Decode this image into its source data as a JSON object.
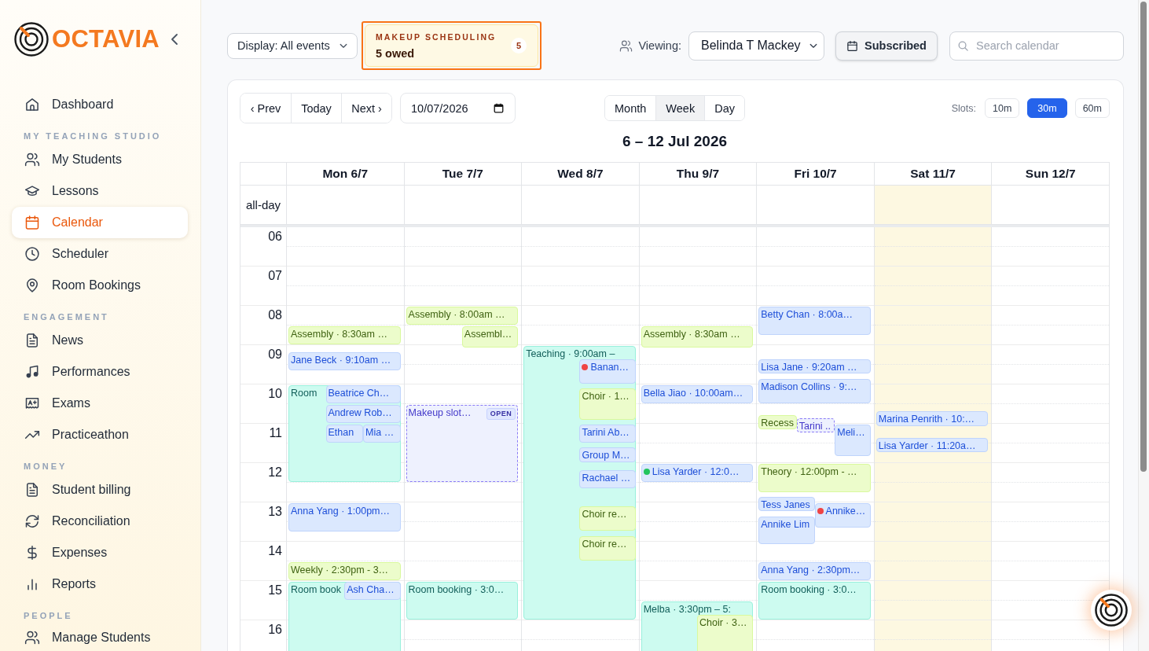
{
  "sidebar": {
    "logo": "OCTAVIA",
    "groups": [
      {
        "items": [
          {
            "label": "Dashboard",
            "selected": false
          }
        ]
      },
      {
        "heading": "MY TEACHING STUDIO",
        "items": [
          {
            "label": "My Students",
            "selected": false
          },
          {
            "label": "Lessons",
            "selected": false
          },
          {
            "label": "Calendar",
            "selected": true
          },
          {
            "label": "Scheduler",
            "selected": false
          },
          {
            "label": "Room Bookings",
            "selected": false
          }
        ]
      },
      {
        "heading": "ENGAGEMENT",
        "items": [
          {
            "label": "News",
            "selected": false
          },
          {
            "label": "Performances",
            "selected": false
          },
          {
            "label": "Exams",
            "selected": false
          },
          {
            "label": "Practiceathon",
            "selected": false
          }
        ]
      },
      {
        "heading": "MONEY",
        "items": [
          {
            "label": "Student billing",
            "selected": false
          },
          {
            "label": "Reconciliation",
            "selected": false
          },
          {
            "label": "Expenses",
            "selected": false
          },
          {
            "label": "Reports",
            "selected": false
          }
        ]
      },
      {
        "heading": "PEOPLE",
        "items": [
          {
            "label": "Manage Students",
            "selected": false
          }
        ]
      }
    ]
  },
  "toolbar": {
    "display_filter": "Display: All events",
    "makeup": {
      "title": "MAKEUP SCHEDULING",
      "summary": "5 owed",
      "count": "5",
      "highlighted": true
    },
    "viewing_label": "Viewing:",
    "viewing_value": "Belinda T Mackey",
    "subscribe_button": "Subscribed",
    "search": {
      "placeholder": "Search calendar"
    }
  },
  "calendar": {
    "nav_buttons": [
      "‹ Prev",
      "Today",
      "Next ›"
    ],
    "date_field": {
      "value": "10/07/2026"
    },
    "views": [
      {
        "label": "Month",
        "selected": false
      },
      {
        "label": "Week",
        "selected": true
      },
      {
        "label": "Day",
        "selected": false
      }
    ],
    "slots_label": "Slots:",
    "slots": [
      {
        "label": "10m",
        "selected": false
      },
      {
        "label": "30m",
        "selected": true
      },
      {
        "label": "60m",
        "selected": false
      }
    ],
    "title": "6 – 12 Jul 2026",
    "all_day_label": "all-day",
    "hours": [
      "06",
      "07",
      "08",
      "09",
      "10",
      "11",
      "12",
      "13",
      "14",
      "15",
      "16"
    ],
    "days": [
      {
        "label": "Mon 6/7",
        "today": false,
        "events": [
          {
            "text": "Assembly · 8:30am …",
            "kind": "group"
          },
          {
            "text": "Jane Beck · 9:10am …",
            "kind": "lesson"
          },
          {
            "text": "Room",
            "kind": "booking"
          },
          {
            "text": "Beatrice Ch…",
            "kind": "lesson"
          },
          {
            "text": "Andrew Rob…",
            "kind": "lesson"
          },
          {
            "text": "Ethan",
            "kind": "lesson"
          },
          {
            "text": "Mia …",
            "kind": "lesson"
          },
          {
            "text": "Anna Yang · 1:00pm…",
            "kind": "lesson"
          },
          {
            "text": "Weekly · 2:30pm - 3…",
            "kind": "group"
          },
          {
            "text": "Room book",
            "kind": "booking"
          },
          {
            "text": "Ash Cha…",
            "kind": "lesson"
          }
        ]
      },
      {
        "label": "Tue 7/7",
        "today": false,
        "events": [
          {
            "text": "Assembly · 8:00am …",
            "kind": "group"
          },
          {
            "text": "Assembl…",
            "kind": "group"
          },
          {
            "text": "Makeup slot…",
            "kind": "makeup",
            "badge": "OPEN"
          },
          {
            "text": "Room booking · 3:0…",
            "kind": "booking"
          }
        ]
      },
      {
        "label": "Wed 8/7",
        "today": false,
        "events": [
          {
            "text": "Teaching · 9:00am –",
            "kind": "booking"
          },
          {
            "text": "Banan…",
            "kind": "lesson",
            "color": "#ef4444"
          },
          {
            "text": "Choir · 1…",
            "kind": "group"
          },
          {
            "text": "Tarini Ab…",
            "kind": "lesson"
          },
          {
            "text": "Group M…",
            "kind": "lesson"
          },
          {
            "text": "Rachael …",
            "kind": "lesson"
          },
          {
            "text": "Choir re…",
            "kind": "group"
          },
          {
            "text": "Choir re…",
            "kind": "group"
          }
        ]
      },
      {
        "label": "Thu 9/7",
        "today": false,
        "events": [
          {
            "text": "Assembly · 8:30am …",
            "kind": "group"
          },
          {
            "text": "Bella Jiao · 10:00am…",
            "kind": "lesson"
          },
          {
            "text": "Lisa Yarder · 12:0…",
            "kind": "lesson",
            "color": "#22c55e"
          },
          {
            "text": "Melba · 3:30pm – 5:",
            "kind": "booking"
          },
          {
            "text": "Choir · 3…",
            "kind": "group"
          }
        ]
      },
      {
        "label": "Fri 10/7",
        "today": false,
        "events": [
          {
            "text": "Betty Chan · 8:00a…",
            "kind": "lesson"
          },
          {
            "text": "Lisa Jane · 9:20am …",
            "kind": "lesson"
          },
          {
            "text": "Madison Collins · 9:…",
            "kind": "lesson"
          },
          {
            "text": "Recess",
            "kind": "group"
          },
          {
            "text": "Tarini ..",
            "kind": "makeup"
          },
          {
            "text": "Meli…",
            "kind": "lesson"
          },
          {
            "text": "Theory · 12:00pm - …",
            "kind": "group"
          },
          {
            "text": "Tess Janes",
            "kind": "lesson"
          },
          {
            "text": "Annike…",
            "kind": "lesson",
            "color": "#ef4444"
          },
          {
            "text": "Annike Lim",
            "kind": "lesson"
          },
          {
            "text": "Anna Yang · 2:30pm…",
            "kind": "lesson"
          },
          {
            "text": "Room booking · 3:0…",
            "kind": "booking"
          }
        ]
      },
      {
        "label": "Sat 11/7",
        "today": true,
        "events": [
          {
            "text": "Marina Penrith · 10:…",
            "kind": "lesson"
          },
          {
            "text": "Lisa Yarder · 11:20a…",
            "kind": "lesson"
          }
        ]
      },
      {
        "label": "Sun 12/7",
        "today": false
      }
    ]
  }
}
